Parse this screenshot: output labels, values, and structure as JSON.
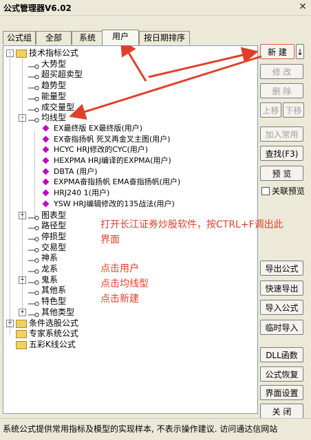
{
  "window": {
    "title": "公式管理器V6.02",
    "close_glyph": "✕"
  },
  "tabs": [
    {
      "label": "公式组"
    },
    {
      "label": "全部"
    },
    {
      "label": "系统"
    },
    {
      "label": "用户"
    },
    {
      "label": "按日期排序"
    }
  ],
  "tree": {
    "root": "技术指标公式",
    "groups_top": [
      "大势型",
      "超买超卖型",
      "趋势型",
      "能量型",
      "成交量型"
    ],
    "expanded_group": "均线型",
    "formulas": [
      "EX最终版  EX最终版(用户)",
      "EX奋指扬帆  死叉再金叉主图(用户)",
      "HCYC  HRJ修改的CYC(用户)",
      "HEXPMA  HRJ编译的EXPMA(用户)",
      "DBTA  (用户)",
      "EXPMA奋指扬帆  EMA奋指扬帆(用户)",
      "HRJ240  1(用户)",
      "YSW  HRJ编辑修改的135战法(用户)"
    ],
    "groups_bottom": [
      "图表型",
      "路径型",
      "停损型",
      "交易型",
      "神系",
      "龙系",
      "鬼系",
      "其他系",
      "特色型",
      "其他类型"
    ],
    "roots_other": [
      "条件选股公式",
      "专家系统公式",
      "五彩K线公式"
    ]
  },
  "buttons": {
    "new": "新  建",
    "new_arrow": "↓",
    "modify": "修  改",
    "delete": "删  除",
    "move_up": "上移",
    "move_down": "下移",
    "add_common": "加入常用",
    "find": "查找(F3)",
    "preview": "预  览",
    "link_preview": "关联预览",
    "export": "导出公式",
    "quick_export": "快速导出",
    "import": "导入公式",
    "temp_import": "临时导入",
    "dll": "DLL函数",
    "restore": "公式恢复",
    "ui_settings": "界面设置",
    "close": "关  闭"
  },
  "status": "系统公式提供常用指标及模型的实现样本, 不表示操作建议.  访问通达信网站",
  "annotation": {
    "line1": "打开长江证券炒股软件，按CTRL+F调出此",
    "line2": "界面",
    "step1": "点击用户",
    "step2": "点击均线型",
    "step3": "点击新建"
  },
  "colors": {
    "annotation": "#e0402a",
    "formula_icon": "#c000c0",
    "folder": "#f1d060"
  }
}
